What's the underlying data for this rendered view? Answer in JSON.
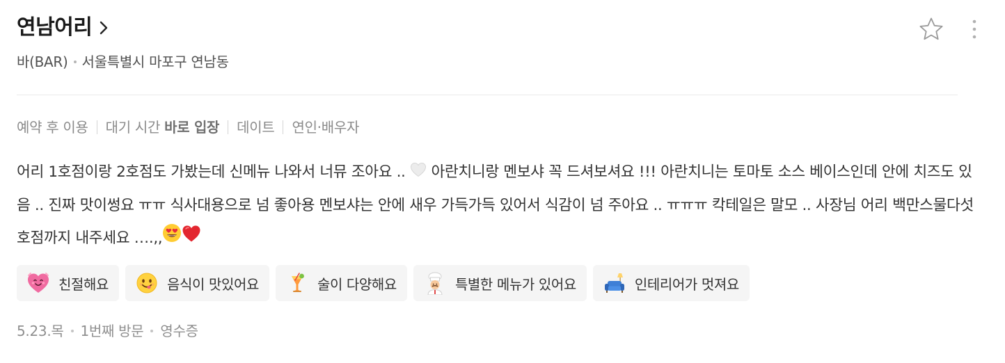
{
  "place": {
    "name": "연남어리",
    "category": "바(BAR)",
    "address": "서울특별시 마포구 연남동"
  },
  "tags": {
    "reservation": "예약 후 이용",
    "wait_label": "대기 시간",
    "wait_value": "바로 입장",
    "purpose": "데이트",
    "companion": "연인·배우자"
  },
  "review": {
    "part1": "어리 1호점이랑 2호점도 가봤는데 신메뉴 나와서 너뮤 조아요 ..",
    "part2": "아란치니랑 멘보샤 꼭 드셔보셔요 !!! 아란치니는 토마토 소스 베이스인데 안에 치즈도 있음 .. 진짜 맛이썽요 ㅠㅠ 식사대용으로 넘 좋아용 멘보샤는 안에 새우 가득가득 있어서 식감이 넘 주아요 .. ㅠㅠㅠ 칵테일은 말모 .. 사장님 어리 백만스물다섯호점까지 내주세요 ….,,",
    "emoji_white_heart": "white-heart-icon",
    "emoji_heart_eyes": "heart-eyes-icon",
    "emoji_red_heart": "red-heart-icon"
  },
  "keywords": [
    {
      "icon": "heart-face-icon",
      "label": "친절해요"
    },
    {
      "icon": "yum-face-icon",
      "label": "음식이 맛있어요"
    },
    {
      "icon": "cocktail-icon",
      "label": "술이 다양해요"
    },
    {
      "icon": "chef-icon",
      "label": "특별한 메뉴가 있어요"
    },
    {
      "icon": "sofa-icon",
      "label": "인테리어가 멋져요"
    }
  ],
  "meta": {
    "date": "5.23.목",
    "visit": "1번째 방문",
    "proof": "영수증"
  },
  "colors": {
    "text_primary": "#1a1a1a",
    "text_secondary": "#8a8a8a",
    "chip_background": "#f5f5f5",
    "divider": "#ebebeb"
  }
}
